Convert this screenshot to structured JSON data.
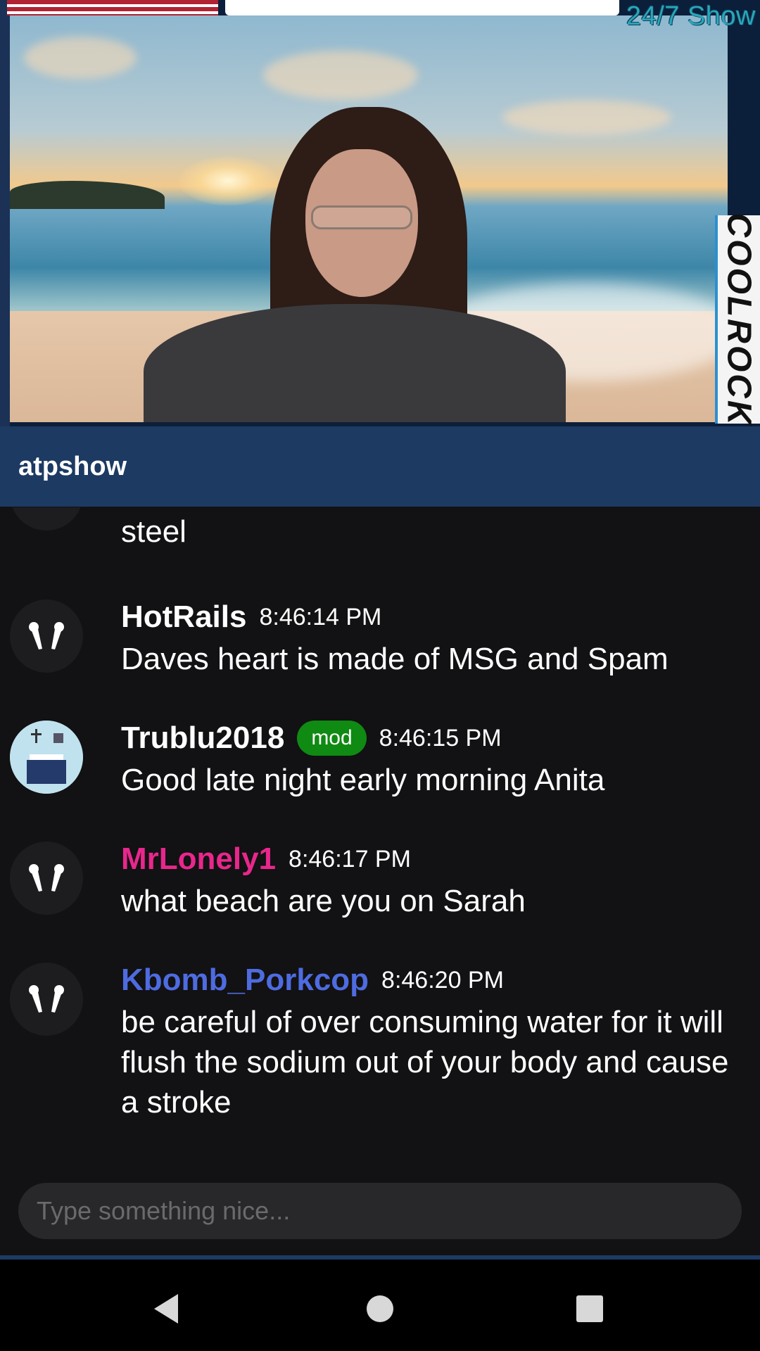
{
  "video": {
    "show_tag": "24/7 Show",
    "side_logo": "COOLROCK"
  },
  "channel": {
    "name": "atpshow"
  },
  "chat": {
    "partial_message_text": "steel",
    "messages": [
      {
        "user": "HotRails",
        "user_color": "#ffffff",
        "time": "8:46:14 PM",
        "badge": "",
        "avatar": "default-avatar-icon",
        "text": "Daves heart is made of MSG and Spam"
      },
      {
        "user": "Trublu2018",
        "user_color": "#ffffff",
        "time": "8:46:15 PM",
        "badge": "mod",
        "avatar": "trublu-avatar-image",
        "text": "Good late night early morning Anita"
      },
      {
        "user": "MrLonely1",
        "user_color": "#e8278c",
        "time": "8:46:17 PM",
        "badge": "",
        "avatar": "default-avatar-icon",
        "text": "what beach are you on Sarah"
      },
      {
        "user": "Kbomb_Porkcop",
        "user_color": "#4e6be0",
        "time": "8:46:20 PM",
        "badge": "",
        "avatar": "default-avatar-icon",
        "text": "be careful of over consuming water for it will flush the sodium out of your body and cause a stroke"
      }
    ]
  },
  "input": {
    "placeholder": "Type something nice..."
  },
  "navbar": {
    "back": "back-icon",
    "home": "home-icon",
    "recents": "recents-icon"
  },
  "colors": {
    "header_bg": "#1d3a63",
    "chat_bg": "#121113",
    "mod_badge": "#0f8a12"
  }
}
